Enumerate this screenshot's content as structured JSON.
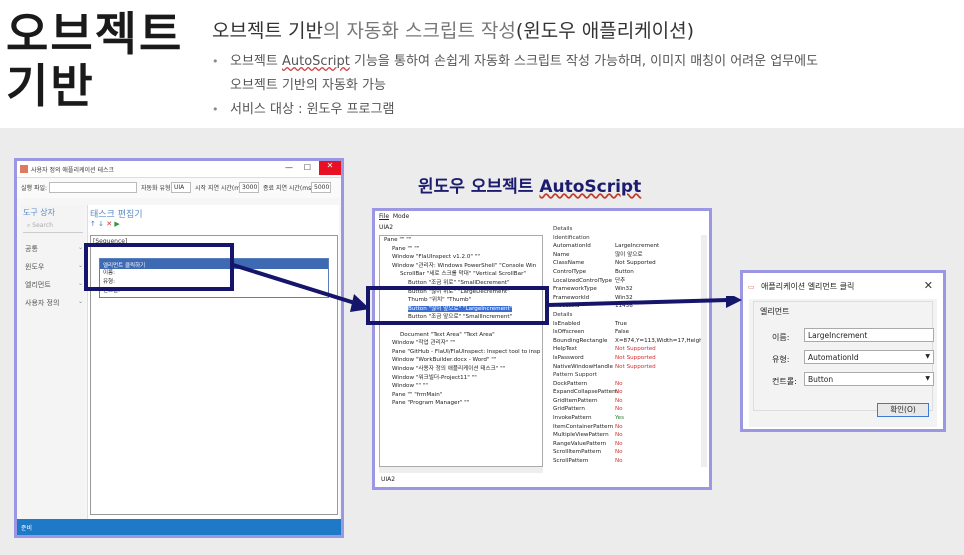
{
  "header": {
    "big_title_line1": "오브젝트",
    "big_title_line2": "기반",
    "subtitle_main": "오브젝트 기반",
    "subtitle_muted": "의 자동화 스크립트 작성",
    "subtitle_end": "(윈도우 애플리케이션)",
    "bullet1_pre": "오브젝트 ",
    "bullet1_wavy": "AutoScript",
    "bullet1_post": " 기능을 통하여 손쉽게 자동화 스크립트 작성 가능하며, 이미지 매칭이 어려운 업무에도",
    "bullet1_cont": "오브젝트 기반의 자동화 가능",
    "bullet2": "서비스 대상 : 윈도우 프로그램"
  },
  "win1": {
    "title": "사용자 정의 애플리케이션 테스크",
    "min": "—",
    "max": "☐",
    "close": "✕",
    "exec_file_label": "실행 파일:",
    "auto_type_label": "자동화 유형:",
    "auto_type_value": "UIA",
    "start_wait_label": "시작 지연 시간(ms):",
    "start_wait_value": "3000",
    "end_wait_label": "종료 지연 시간(ms):",
    "end_wait_value": "5000",
    "toolbox_header": "도구 상자",
    "search_placeholder": "Search",
    "side_items": [
      "공통",
      "윈도우",
      "엘리먼트",
      "사용자 정의"
    ],
    "task_editor_header": "태스크 편집기",
    "sequence_label": "[Sequence]",
    "activity_title": "엘리먼트 클릭하기",
    "activity_lines": [
      "이름:",
      "유형:",
      "컨트롤:"
    ],
    "status": "준비"
  },
  "middle": {
    "title_pre": "윈도우 오브젝트 ",
    "title_u": "AutoScript",
    "menu": [
      "File",
      "Mode"
    ],
    "uia2_label": "UIA2",
    "details_label": "Details",
    "footer": "UIA2",
    "tree": [
      "Pane \"\" \"\"",
      "  Pane \"\" \"\"",
      "  Window \"FlaUInspect v1.2.0\" \"\"",
      "  Window \"관리자: Windows PowerShell\" \"Console Win",
      "    ScrollBar \"세로 스크롤 막대\" \"Vertical ScrollBar\"",
      "      Button \"조금 위로\" \"SmallDecrement\"",
      "      Button \"많이 위로\" \"LargeDecrement\"",
      "      Thumb \"위치\" \"Thumb\"",
      "      Button \"많이 앞으로\" \"LargeIncrement\"",
      "      Button \"조금 앞으로\" \"SmallIncrement\"",
      "",
      "    Document \"Text Area\" \"Text Area\"",
      "  Window \"작업 관리자\" \"\"",
      "  Pane \"GitHub - FlaUI/FlaUInspect: Inspect tool to insp",
      "  Window \"WorkBuilder.docx - Word\" \"\"",
      "  Window \"사용자 정의 애플리케이션 태스크\" \"\"",
      "  Window \"워크빌더-Project11\" \"\"",
      "  Window \"\" \"\"",
      "  Pane \"\" \"frmMain\"",
      "  Pane \"Program Manager\" \"\""
    ],
    "selected_index": 8,
    "identification_label": "Identification",
    "details_label2": "Details",
    "pattern_label": "Pattern Support",
    "ident": [
      [
        "AutomationId",
        "LargeIncrement"
      ],
      [
        "Name",
        "많이 앞으로"
      ],
      [
        "ClassName",
        "Not Supported"
      ],
      [
        "ControlType",
        "Button"
      ],
      [
        "LocalizedControlType",
        "단추"
      ],
      [
        "FrameworkType",
        "Win32"
      ],
      [
        "FrameworkId",
        "Win32"
      ],
      [
        "ProcessId",
        "11436"
      ]
    ],
    "det": [
      [
        "IsEnabled",
        "True"
      ],
      [
        "IsOffscreen",
        "False"
      ],
      [
        "BoundingRectangle",
        "X=874,Y=113,Width=17,Height="
      ],
      [
        "HelpText",
        "Not Supported"
      ],
      [
        "IsPassword",
        "Not Supported"
      ],
      [
        "NativeWindowHandle",
        "Not Supported"
      ]
    ],
    "patterns": [
      [
        "DockPattern",
        "No"
      ],
      [
        "ExpandCollapsePattern",
        "No"
      ],
      [
        "GridItemPattern",
        "No"
      ],
      [
        "GridPattern",
        "No"
      ],
      [
        "InvokePattern",
        "Yes"
      ],
      [
        "ItemContainerPattern",
        "No"
      ],
      [
        "MultipleViewPattern",
        "No"
      ],
      [
        "RangeValuePattern",
        "No"
      ],
      [
        "ScrollItemPattern",
        "No"
      ],
      [
        "ScrollPattern",
        "No"
      ]
    ]
  },
  "win3": {
    "title": "애플리케이션 엘리먼트 클릭",
    "close": "✕",
    "group_label": "엘리먼트",
    "name_label": "이름:",
    "name_value": "LargeIncrement",
    "type_label": "유형:",
    "type_value": "AutomationId",
    "control_label": "컨트롤:",
    "control_value": "Button",
    "ok_button": "확인(O)"
  }
}
